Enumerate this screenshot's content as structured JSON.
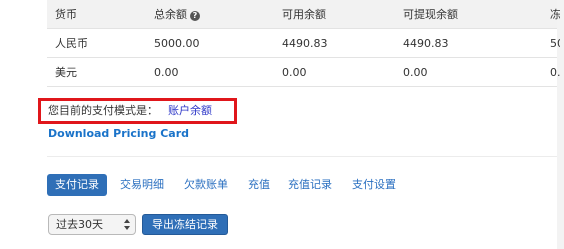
{
  "balance_table": {
    "headers": [
      "货币",
      "总余额",
      "可用余额",
      "可提现余额",
      "冻"
    ],
    "info_icon": "question-circle-icon",
    "rows": [
      [
        "人民币",
        "5000.00",
        "4490.83",
        "4490.83",
        "50"
      ],
      [
        "美元",
        "0.00",
        "0.00",
        "0.00",
        "0.0"
      ]
    ]
  },
  "payment_mode": {
    "label": "您目前的支付模式是：",
    "value": "账户余额"
  },
  "download_link": "Download Pricing Card",
  "tabs": [
    "支付记录",
    "交易明细",
    "欠款账单",
    "充值",
    "充值记录",
    "支付设置"
  ],
  "active_tab": "支付记录",
  "period_select": {
    "value": "过去30天"
  },
  "export_button": "导出冻结记录",
  "colors": {
    "accent": "#2f6fb7",
    "link": "#1a73c9",
    "mode_value": "#2b35c7",
    "highlight": "#e0161b",
    "header_bg": "#f2f2f2"
  }
}
